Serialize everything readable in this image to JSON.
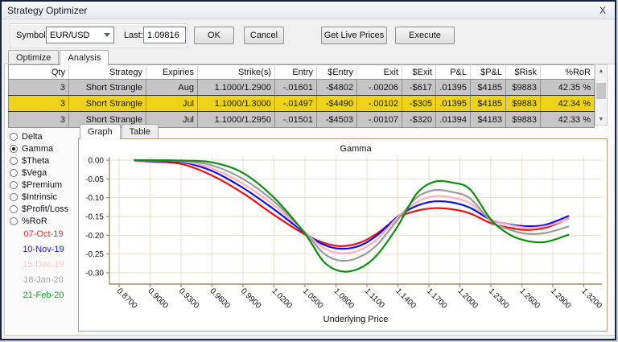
{
  "window": {
    "title": "Strategy Optimizer",
    "close_glyph": "X"
  },
  "toolbar": {
    "symbol_label": "Symbol:",
    "symbol_value": "EUR/USD",
    "last_label": "Last:",
    "last_value": "1.09816",
    "ok_label": "OK",
    "cancel_label": "Cancel",
    "get_live_prices_label": "Get Live Prices",
    "execute_label": "Execute"
  },
  "main_tabs": [
    {
      "label": "Optimize",
      "active": false
    },
    {
      "label": "Analysis",
      "active": true
    }
  ],
  "table": {
    "columns": [
      "Qty",
      "Strategy",
      "Expiries",
      "Strike(s)",
      "Entry",
      "$Entry",
      "Exit",
      "$Exit",
      "P&L",
      "$P&L",
      "$Risk",
      "%RoR"
    ],
    "rows": [
      {
        "selected": false,
        "cells": [
          "3",
          "Short Strangle",
          "Aug",
          "1.1000/1.2900",
          "-.01601",
          "-$4802",
          "-.00206",
          "-$617",
          ".01395",
          "$4185",
          "$9883",
          "42.35 %"
        ]
      },
      {
        "selected": true,
        "cells": [
          "3",
          "Short Strangle",
          "Jul",
          "1.1000/1.3000",
          "-.01497",
          "-$4490",
          "-.00102",
          "-$305",
          ".01395",
          "$4185",
          "$9883",
          "42.34 %"
        ]
      },
      {
        "selected": false,
        "cells": [
          "3",
          "Short Strangle",
          "Jul",
          "1.1000/1.2950",
          "-.01501",
          "-$4503",
          "-.00107",
          "-$320",
          ".01394",
          "$4183",
          "$9883",
          "42.33 %"
        ]
      }
    ],
    "selected_row_color": "#efd319",
    "row_color": "#c6c6c6",
    "scroll_up_glyph": "▲",
    "scroll_down_glyph": "▼"
  },
  "metric_options": {
    "items": [
      "Delta",
      "Gamma",
      "$Theta",
      "$Vega",
      "$Premium",
      "$Intrinsic",
      "$Profit/Loss",
      "%RoR"
    ],
    "selected": "Gamma"
  },
  "legend_dates": [
    {
      "label": "07-Oct-19",
      "color": "#e03030"
    },
    {
      "label": "10-Nov-19",
      "color": "#1a1af0"
    },
    {
      "label": "15-Dec-19",
      "color": "#ffc6d0"
    },
    {
      "label": "18-Jan-20",
      "color": "#a8a8a8"
    },
    {
      "label": "21-Feb-20",
      "color": "#14a02c"
    }
  ],
  "chart_tabs": [
    {
      "label": "Graph",
      "active": true
    },
    {
      "label": "Table",
      "active": false
    }
  ],
  "chart_data": {
    "type": "line",
    "title": "Gamma",
    "xlabel": "Underlying Price",
    "x_tick_labels": [
      "0.8700",
      "0.9000",
      "0.9300",
      "0.9600",
      "0.9900",
      "1.0200",
      "1.0500",
      "1.0800",
      "1.1100",
      "1.1400",
      "1.1700",
      "1.2000",
      "1.2300",
      "1.2600",
      "1.2900",
      "1.3200"
    ],
    "x_tick_values": [
      0.87,
      0.9,
      0.93,
      0.96,
      0.99,
      1.02,
      1.05,
      1.08,
      1.11,
      1.14,
      1.17,
      1.2,
      1.23,
      1.26,
      1.29,
      1.32
    ],
    "y_tick_labels": [
      "0.00",
      "-0.05",
      "-0.10",
      "-0.15",
      "-0.20",
      "-0.25",
      "-0.30"
    ],
    "y_tick_values": [
      0,
      -0.05,
      -0.1,
      -0.15,
      -0.2,
      -0.25,
      -0.3
    ],
    "xlim": [
      0.861,
      1.327
    ],
    "ylim": [
      -0.33,
      0.005
    ],
    "grid": true,
    "grid_color": "#eadfc9",
    "axis_color": "#9c8e6e",
    "x": [
      0.885,
      0.9,
      0.93,
      0.96,
      0.99,
      1.02,
      1.05,
      1.068,
      1.085,
      1.103,
      1.12,
      1.14,
      1.158,
      1.175,
      1.193,
      1.21,
      1.23,
      1.248,
      1.265,
      1.283,
      1.305
    ],
    "series": [
      {
        "name": "07-Oct-19",
        "color": "#ee1111",
        "values": [
          -0.001,
          -0.004,
          -0.01,
          -0.041,
          -0.088,
          -0.146,
          -0.198,
          -0.22,
          -0.229,
          -0.22,
          -0.195,
          -0.153,
          -0.135,
          -0.128,
          -0.131,
          -0.142,
          -0.168,
          -0.18,
          -0.186,
          -0.18,
          -0.156
        ]
      },
      {
        "name": "10-Nov-19",
        "color": "#0b0bee",
        "values": [
          0.0,
          -0.002,
          -0.005,
          -0.029,
          -0.074,
          -0.131,
          -0.194,
          -0.225,
          -0.236,
          -0.228,
          -0.2,
          -0.15,
          -0.122,
          -0.11,
          -0.113,
          -0.127,
          -0.159,
          -0.171,
          -0.176,
          -0.172,
          -0.149
        ]
      },
      {
        "name": "15-Dec-19",
        "color": "#ffafc0",
        "values": [
          0.0,
          -0.001,
          -0.003,
          -0.022,
          -0.063,
          -0.12,
          -0.192,
          -0.234,
          -0.248,
          -0.24,
          -0.21,
          -0.152,
          -0.112,
          -0.096,
          -0.1,
          -0.115,
          -0.157,
          -0.172,
          -0.18,
          -0.176,
          -0.157
        ]
      },
      {
        "name": "18-Jan-20",
        "color": "#9b9b9b",
        "values": [
          0.0,
          -0.001,
          -0.002,
          -0.014,
          -0.05,
          -0.11,
          -0.192,
          -0.248,
          -0.268,
          -0.258,
          -0.225,
          -0.158,
          -0.1,
          -0.08,
          -0.085,
          -0.102,
          -0.162,
          -0.185,
          -0.196,
          -0.194,
          -0.177
        ]
      },
      {
        "name": "21-Feb-20",
        "color": "#0d8f0d",
        "values": [
          0.0,
          0.0,
          -0.001,
          -0.006,
          -0.034,
          -0.1,
          -0.196,
          -0.27,
          -0.296,
          -0.288,
          -0.252,
          -0.175,
          -0.09,
          -0.058,
          -0.06,
          -0.078,
          -0.158,
          -0.198,
          -0.215,
          -0.218,
          -0.199
        ]
      }
    ]
  }
}
